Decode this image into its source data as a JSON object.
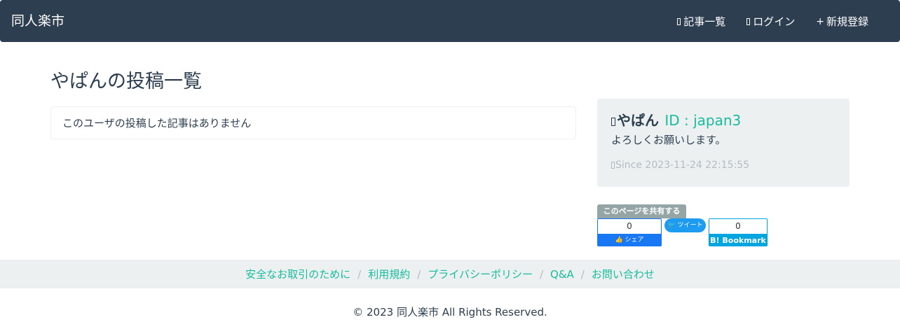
{
  "nav": {
    "brand": "同人楽市",
    "links": [
      {
        "label": "記事一覧",
        "icon": "list-icon"
      },
      {
        "label": "ログイン",
        "icon": "login-icon"
      },
      {
        "label": "新規登録",
        "icon": "plus-icon",
        "glyph": "+"
      }
    ]
  },
  "main": {
    "title": "やぱんの投稿一覧",
    "empty_message": "このユーザの投稿した記事はありません"
  },
  "profile": {
    "name": "やぱん",
    "id_text": "ID : japan3",
    "bio": "よろしくお願いします。",
    "since": "Since 2023-11-24 22:15:55"
  },
  "share": {
    "label": "このページを共有する",
    "facebook": {
      "count": "0",
      "button": "シェア"
    },
    "twitter": {
      "button": "ツイート"
    },
    "hatena": {
      "count": "0",
      "button": "B! Bookmark"
    }
  },
  "footer": {
    "links": [
      "安全なお取引のために",
      "利用規約",
      "プライバシーポリシー",
      "Q&A",
      "お問い合わせ"
    ],
    "separator": "/",
    "copyright": "© 2023 同人楽市 All Rights Reserved."
  },
  "colors": {
    "navbar": "#2c3e50",
    "accent": "#18bc9c",
    "panel": "#ecf0f1",
    "facebook": "#1877f2",
    "twitter": "#1d9bf0",
    "hatena": "#00a4de"
  }
}
